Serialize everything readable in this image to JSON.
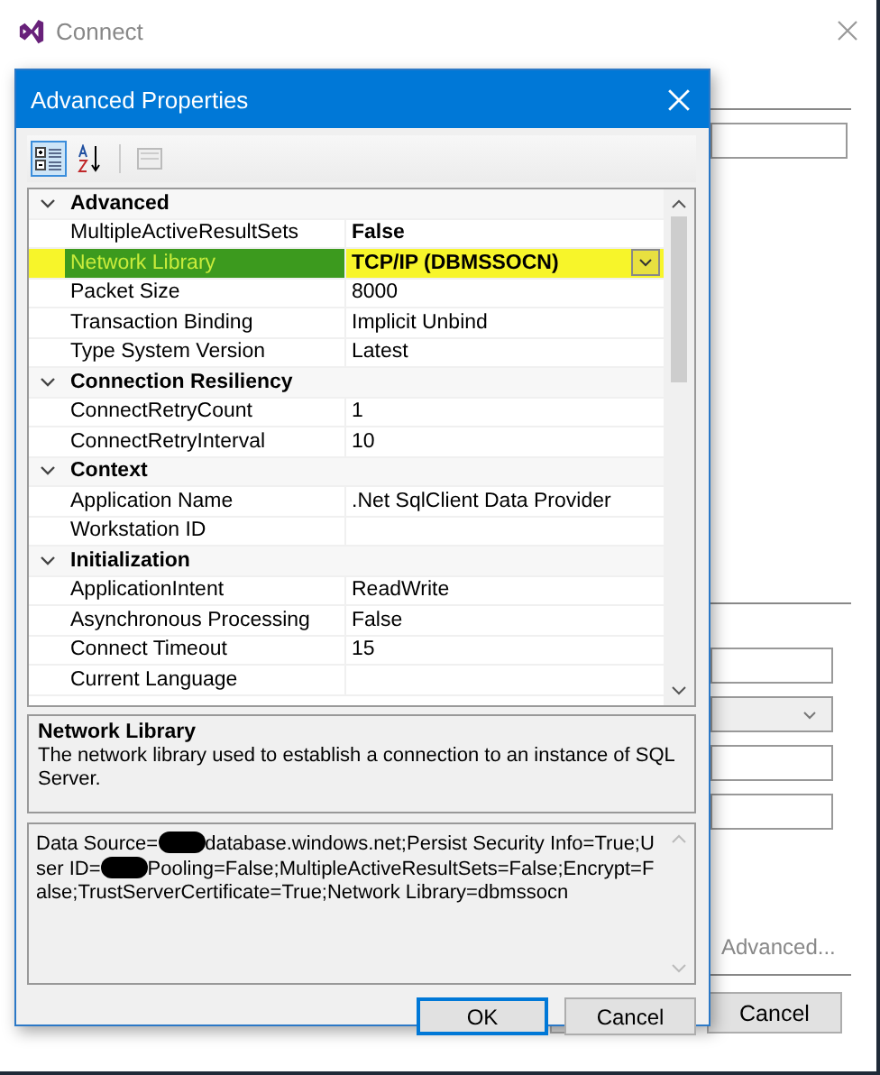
{
  "window": {
    "title": "Connect"
  },
  "background_form": {
    "advanced_link": "Advanced...",
    "buttons": [
      {
        "label": "Cancel"
      }
    ]
  },
  "dialog": {
    "title": "Advanced Properties",
    "toolbar": [
      {
        "kind": "categorized",
        "selected": true
      },
      {
        "kind": "alphabetical",
        "selected": false
      },
      {
        "kind": "property_pages",
        "selected": false
      }
    ],
    "categories": [
      {
        "name": "Advanced",
        "expanded": true,
        "properties": [
          {
            "name": "MultipleActiveResultSets",
            "value": "False",
            "modified": true,
            "selected": false
          },
          {
            "name": "Network Library",
            "value": "TCP/IP (DBMSSOCN)",
            "modified": true,
            "selected": true
          },
          {
            "name": "Packet Size",
            "value": "8000",
            "modified": false,
            "selected": false
          },
          {
            "name": "Transaction Binding",
            "value": "Implicit Unbind",
            "modified": false,
            "selected": false
          },
          {
            "name": "Type System Version",
            "value": "Latest",
            "modified": false,
            "selected": false
          }
        ]
      },
      {
        "name": "Connection Resiliency",
        "expanded": true,
        "properties": [
          {
            "name": "ConnectRetryCount",
            "value": "1",
            "modified": false,
            "selected": false
          },
          {
            "name": "ConnectRetryInterval",
            "value": "10",
            "modified": false,
            "selected": false
          }
        ]
      },
      {
        "name": "Context",
        "expanded": true,
        "properties": [
          {
            "name": "Application Name",
            "value": ".Net SqlClient Data Provider",
            "modified": false,
            "selected": false
          },
          {
            "name": "Workstation ID",
            "modified": false,
            "selected": false
          }
        ]
      },
      {
        "name": "Initialization",
        "expanded": true,
        "properties": [
          {
            "name": "ApplicationIntent",
            "value": "ReadWrite",
            "modified": false,
            "selected": false
          },
          {
            "name": "Asynchronous Processing",
            "value": "False",
            "modified": false,
            "selected": false
          },
          {
            "name": "Connect Timeout",
            "value": "15",
            "modified": false,
            "selected": false
          },
          {
            "name": "Current Language",
            "modified": false,
            "selected": false
          }
        ]
      }
    ],
    "description": {
      "title": "Network Library",
      "text": "The network library used to establish a connection to an instance of SQL Server."
    },
    "connection_string": [
      {
        "kind": "text",
        "text": "Data Source="
      },
      {
        "kind": "redacted"
      },
      {
        "kind": "text",
        "text": "database.windows.net;Persist Security Info=True;User ID="
      },
      {
        "kind": "redacted"
      },
      {
        "kind": "text",
        "text": "Pooling=False;MultipleActiveResultSets=False;Encrypt=False;TrustServerCertificate=True;Network Library=dbmssocn"
      }
    ],
    "buttons": [
      {
        "label": "OK",
        "default": true
      },
      {
        "label": "Cancel",
        "default": false
      }
    ]
  }
}
